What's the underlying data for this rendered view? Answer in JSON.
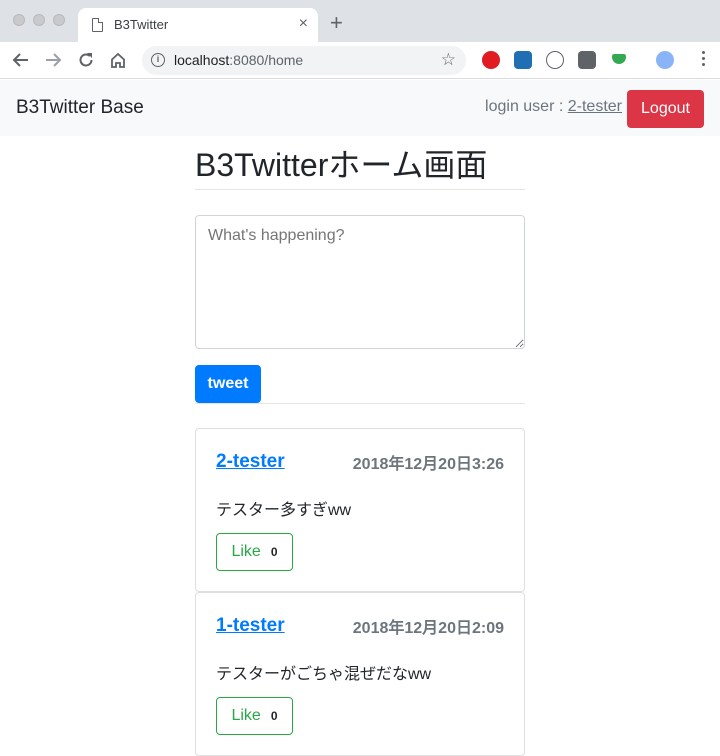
{
  "browser": {
    "tab_title": "B3Twitter",
    "tab_close": "×",
    "new_tab": "+",
    "url_host": "localhost",
    "url_rest": ":8080/home"
  },
  "navbar": {
    "brand": "B3Twitter Base",
    "login_prefix": "login user : ",
    "login_user": "2-tester",
    "logout_label": "Logout"
  },
  "main": {
    "title": "B3Twitterホーム画面",
    "compose_placeholder": "What's happening?",
    "tweet_label": "tweet"
  },
  "tweets": [
    {
      "user": "2-tester",
      "date": "2018年12月20日3:26",
      "text": "テスター多すぎww",
      "like_label": "Like",
      "like_count": "0"
    },
    {
      "user": "1-tester",
      "date": "2018年12月20日2:09",
      "text": "テスターがごちゃ混ぜだなww",
      "like_label": "Like",
      "like_count": "0"
    }
  ],
  "colors": {
    "primary": "#007bff",
    "danger": "#dc3545",
    "success": "#28a745"
  }
}
